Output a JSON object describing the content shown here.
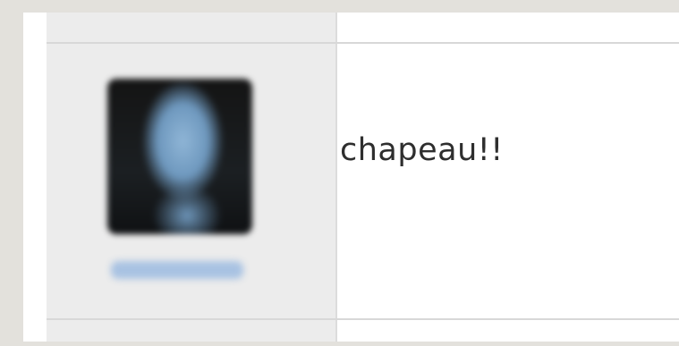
{
  "post": {
    "message": "chapeau!!"
  },
  "author": {
    "avatar_icon": "user-avatar-icon",
    "link_color": "#a8c2e2"
  },
  "colors": {
    "page_bg": "#e3e1dc",
    "sidebar_bg": "#ececec",
    "content_bg": "#ffffff",
    "text": "#2e2e2e"
  }
}
